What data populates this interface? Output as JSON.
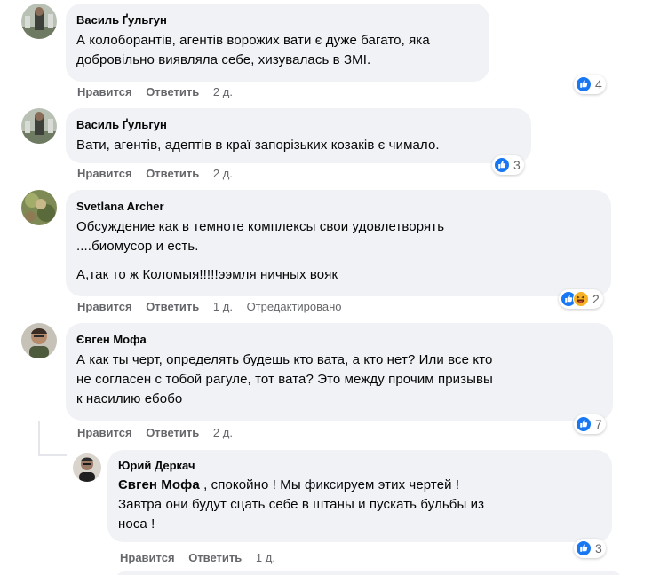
{
  "comments": [
    {
      "author": "Василь Ґульгун",
      "lines": [
        "А колоборантів, агентів ворожих вати є дуже багато, яка",
        "добровільно виявляла себе, хизувалась в ЗМІ."
      ],
      "reactions": "4",
      "like_label": "Нравится",
      "reply_label": "Ответить",
      "time": "2 д."
    },
    {
      "author": "Василь Ґульгун",
      "lines": [
        "Вати, агентів, адептів в краї запорізьких козаків є чимало."
      ],
      "reactions": "3",
      "like_label": "Нравится",
      "reply_label": "Ответить",
      "time": "2 д."
    },
    {
      "author": "Svetlana Archer",
      "lines": [
        "Обсуждение как в темноте комплексы свои удовлетворять",
        "....биомусор и есть."
      ],
      "para2": "А,так то ж Коломыя!!!!!ээмля ничных вояк",
      "reactions": "2",
      "like_label": "Нравится",
      "reply_label": "Ответить",
      "time": "1 д.",
      "edited": "Отредактировано"
    },
    {
      "author": "Євген Мофа",
      "lines": [
        "А как ты черт, определять будешь кто вата, а кто нет? Или все кто",
        "не согласен с тобой рагуле, тот вата? Это между прочим призывы",
        "к насилию ебобо"
      ],
      "reactions": "7",
      "like_label": "Нравится",
      "reply_label": "Ответить",
      "time": "2 д."
    },
    {
      "author": "Юрий Деркач",
      "mention": "Євген Мофа",
      "line1_rest": " , спокойно ! Мы фиксируем этих чертей !",
      "lines": [
        "Завтра они будут сцать себе в штаны и пускать бульбы из",
        "носа !"
      ],
      "reactions": "3",
      "like_label": "Нравится",
      "reply_label": "Ответить",
      "time": "1 д."
    }
  ],
  "colors": {
    "bubble": "#f0f2f5",
    "meta": "#65676b",
    "like_blue": "#1877f2",
    "haha_yellow": "#f7b125"
  }
}
